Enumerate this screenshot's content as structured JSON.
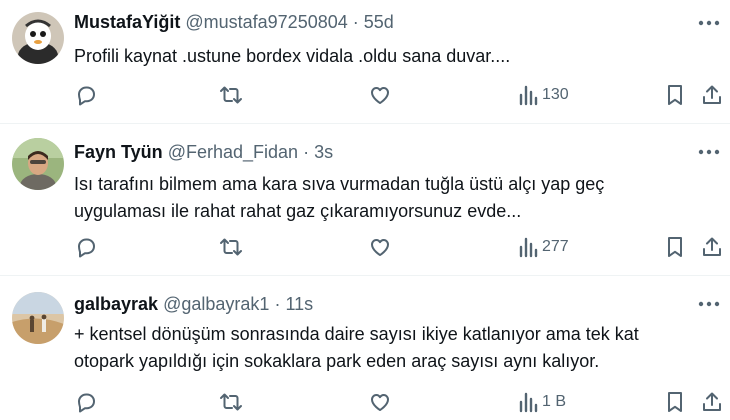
{
  "tweets": [
    {
      "name": "MustafaYiğit",
      "handle": "@mustafa97250804",
      "sep": "·",
      "time": "55d",
      "text": "Profili kaynat .ustune bordex vidala .oldu sana duvar....",
      "views": "130"
    },
    {
      "name": "Fayn Tyün",
      "handle": "@Ferhad_Fidan",
      "sep": "·",
      "time": "3s",
      "text": "Isı tarafını bilmem ama kara sıva vurmadan tuğla üstü alçı yap geç uygulaması ile rahat rahat gaz çıkaramıyorsunuz evde...",
      "views": "277"
    },
    {
      "name": "galbayrak",
      "handle": "@galbayrak1",
      "sep": "·",
      "time": "11s",
      "text": "+ kentsel dönüşüm sonrasında daire sayısı ikiye katlanıyor ama tek kat otopark yapıldığı için sokaklara park eden araç sayısı aynı kalıyor.",
      "views": "1 B"
    }
  ],
  "icons": {
    "reply": "reply-icon",
    "repost": "repost-icon",
    "like": "like-icon",
    "views": "views-icon",
    "bookmark": "bookmark-icon",
    "share": "share-icon",
    "more": "more-icon"
  },
  "colors": {
    "text": "#0f1419",
    "secondary": "#536471",
    "divider": "#eff3f4"
  }
}
